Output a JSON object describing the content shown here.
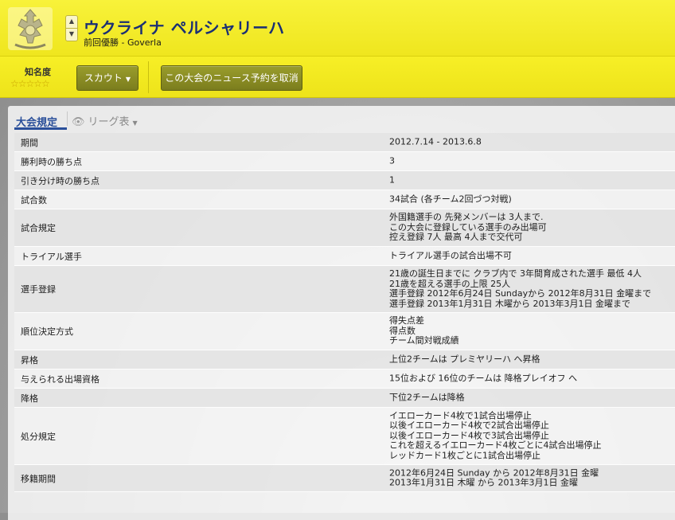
{
  "header": {
    "title": "ウクライナ ペルシャリーハ",
    "subtitle": "前回優勝 - Goverla",
    "nav_up_icon": "chevron-up-icon",
    "nav_down_icon": "chevron-down-icon"
  },
  "toolbar": {
    "fame_label": "知名度",
    "fame_rating": 0,
    "fame_max": 5,
    "stars_text": "☆☆☆☆☆",
    "scout_label": "スカウト",
    "scout_caret": "▼",
    "cancel_news_label": "この大会のニュース予約を取消"
  },
  "tabs": {
    "rules": "大会規定",
    "league": "リーグ表",
    "league_icon": "eye-icon",
    "league_caret": "▼"
  },
  "rules": [
    {
      "label": "期間",
      "lines": [
        "2012.7.14 - 2013.6.8"
      ]
    },
    {
      "label": "勝利時の勝ち点",
      "lines": [
        "3"
      ]
    },
    {
      "label": "引き分け時の勝ち点",
      "lines": [
        "1"
      ]
    },
    {
      "label": "試合数",
      "lines": [
        "34試合 (各チーム2回づつ対戦)"
      ]
    },
    {
      "label": "試合規定",
      "lines": [
        "外国籍選手の 先発メンバーは 3人まで.",
        "この大会に登録している選手のみ出場可",
        "控え登録 7人 最高 4人まで交代可"
      ]
    },
    {
      "label": "トライアル選手",
      "lines": [
        "トライアル選手の試合出場不可"
      ]
    },
    {
      "label": "選手登録",
      "lines": [
        "21歳の誕生日までに クラブ内で 3年間育成された選手 最低 4人",
        "21歳を超える選手の上限 25人",
        "選手登録 2012年6月24日 Sundayから 2012年8月31日 金曜まで",
        "選手登録 2013年1月31日 木曜から 2013年3月1日 金曜まで"
      ]
    },
    {
      "label": "順位決定方式",
      "lines": [
        "得失点差",
        "得点数",
        "チーム間対戦成績"
      ]
    },
    {
      "label": "昇格",
      "lines": [
        "上位2チームは プレミヤリーハ へ昇格"
      ]
    },
    {
      "label": "与えられる出場資格",
      "lines": [
        "15位および 16位のチームは 降格プレイオフ へ"
      ]
    },
    {
      "label": "降格",
      "lines": [
        "下位2チームは降格"
      ]
    },
    {
      "label": "処分規定",
      "lines": [
        "イエローカード4枚で1試合出場停止",
        "以後イエローカード4枚で2試合出場停止",
        "以後イエローカード4枚で3試合出場停止",
        "これを超えるイエローカード4枚ごとに4試合出場停止",
        "レッドカード1枚ごとに1試合出場停止"
      ]
    },
    {
      "label": "移籍期間",
      "lines": [
        "2012年6月24日 Sunday から 2012年8月31日 金曜",
        "2013年1月31日 木曜 から 2013年3月1日 金曜"
      ]
    }
  ]
}
